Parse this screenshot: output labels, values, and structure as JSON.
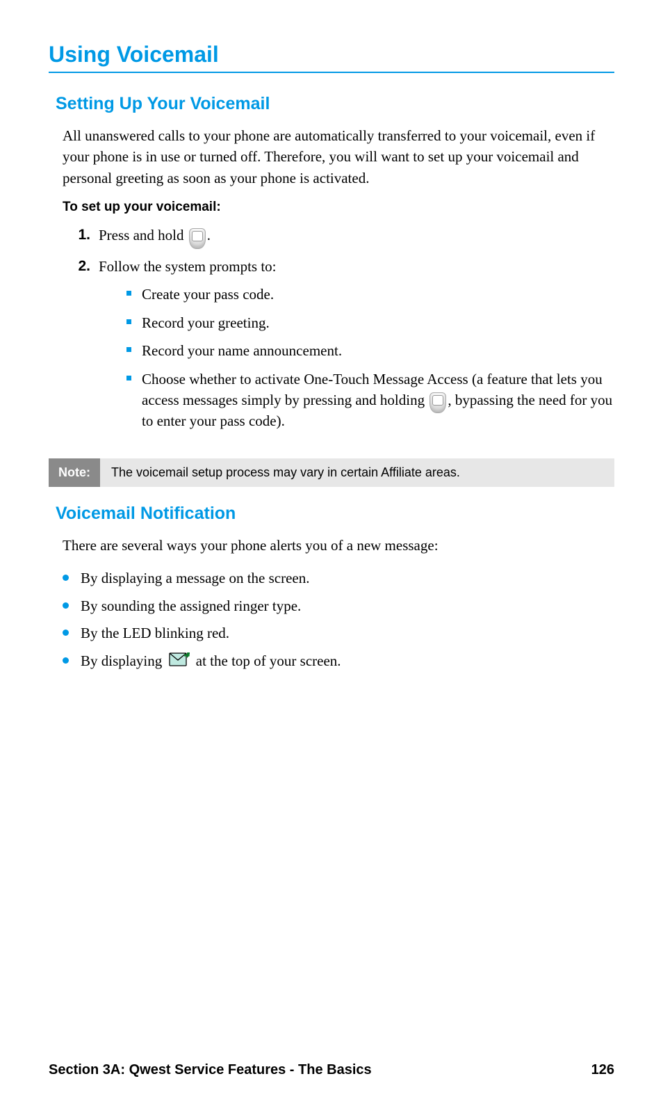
{
  "heading": "Using Voicemail",
  "section1": {
    "title": "Setting Up Your Voicemail",
    "intro": "All unanswered calls to your phone are automatically transferred to your voicemail, even if your phone is in use or turned off. Therefore, you will want to set up your voicemail and personal greeting as soon as your phone is activated.",
    "instruction_label": "To set up your voicemail:",
    "step1_a": "Press and hold ",
    "step1_b": ".",
    "step2": "Follow the system prompts to:",
    "sub1": "Create your pass code.",
    "sub2": "Record your greeting.",
    "sub3": "Record your name announcement.",
    "sub4_a": "Choose whether to activate One-Touch Message Access (a feature that lets you access messages simply by pressing and holding ",
    "sub4_b": ", bypassing the need for you to enter your pass code)."
  },
  "note": {
    "label": "Note:",
    "text": "The voicemail setup process may vary in certain Affiliate areas."
  },
  "section2": {
    "title": "Voicemail Notification",
    "intro": "There are several ways your phone alerts you of a new message:",
    "b1": "By displaying a message on the screen.",
    "b2": "By sounding the assigned ringer type.",
    "b3": "By the LED blinking red.",
    "b4_a": "By displaying ",
    "b4_b": " at the top of your screen."
  },
  "footer": {
    "left": "Section 3A: Qwest Service Features - The Basics",
    "right": "126"
  },
  "num1": "1.",
  "num2": "2."
}
